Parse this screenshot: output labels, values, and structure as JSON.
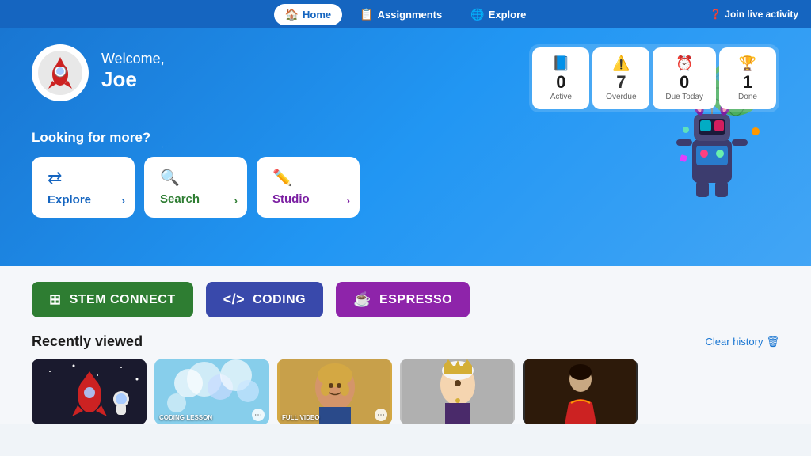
{
  "nav": {
    "items": [
      {
        "id": "home",
        "label": "Home",
        "icon": "🏠",
        "active": true
      },
      {
        "id": "assignments",
        "label": "Assignments",
        "icon": "📋",
        "active": false
      },
      {
        "id": "explore",
        "label": "Explore",
        "icon": "🌐",
        "active": false
      }
    ],
    "join_live": "Join live activity"
  },
  "hero": {
    "welcome_greeting": "Welcome,",
    "user_name": "Joe",
    "stats": [
      {
        "id": "active",
        "label": "Active",
        "value": "0",
        "icon": "📘",
        "type": "active"
      },
      {
        "id": "overdue",
        "label": "Overdue",
        "value": "7",
        "icon": "⚠",
        "type": "overdue"
      },
      {
        "id": "due_today",
        "label": "Due Today",
        "value": "0",
        "icon": "⏰",
        "type": "due-today"
      },
      {
        "id": "done",
        "label": "Done",
        "value": "1",
        "icon": "🏆",
        "type": "done"
      }
    ],
    "looking_more": "Looking for more?",
    "shortcuts": [
      {
        "id": "explore",
        "label": "Explore",
        "icon": "⇄",
        "type": "explore"
      },
      {
        "id": "search",
        "label": "Search",
        "icon": "🔍",
        "type": "search"
      },
      {
        "id": "studio",
        "label": "Studio",
        "icon": "✏",
        "type": "studio"
      }
    ]
  },
  "products": [
    {
      "id": "stem",
      "label": "STEM CONNECT",
      "icon": "⊞",
      "type": "stem"
    },
    {
      "id": "coding",
      "label": "CODING",
      "icon": "</>",
      "type": "coding"
    },
    {
      "id": "espresso",
      "label": "ESPRESSO",
      "icon": "☕",
      "type": "espresso"
    }
  ],
  "recently_viewed": {
    "title": "Recently viewed",
    "clear_label": "Clear history",
    "items": [
      {
        "id": 1,
        "label": "",
        "bg": "thumb-1",
        "emoji": "🚀"
      },
      {
        "id": 2,
        "label": "CODING LESSON",
        "bg": "thumb-2",
        "emoji": "🫧"
      },
      {
        "id": 3,
        "label": "FULL VIDEO",
        "bg": "thumb-3",
        "emoji": "🎨"
      },
      {
        "id": 4,
        "label": "",
        "bg": "thumb-4",
        "emoji": "👑"
      },
      {
        "id": 5,
        "label": "",
        "bg": "thumb-5",
        "emoji": "🎭"
      }
    ]
  }
}
